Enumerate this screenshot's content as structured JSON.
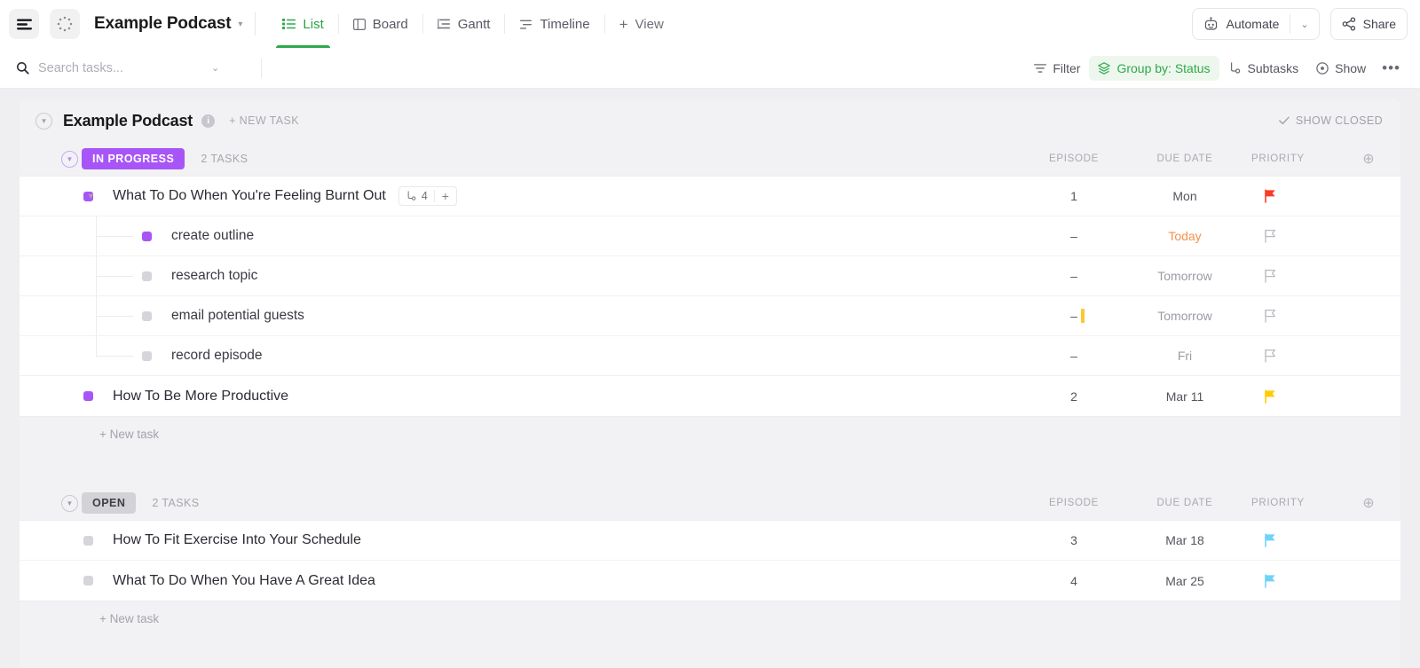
{
  "topbar": {
    "menu_icon": "hamburger-menu-icon",
    "space_icon": "dotted-circle-icon",
    "project_title": "Example Podcast",
    "caret": "▾",
    "tabs": [
      {
        "label": "List",
        "icon": "list-view-icon",
        "active": true
      },
      {
        "label": "Board",
        "icon": "board-view-icon",
        "active": false
      },
      {
        "label": "Gantt",
        "icon": "gantt-view-icon",
        "active": false
      },
      {
        "label": "Timeline",
        "icon": "timeline-view-icon",
        "active": false
      }
    ],
    "add_view_label": "View",
    "add_view_icon": "plus-icon",
    "automate_label": "Automate",
    "automate_icon": "robot-icon",
    "automate_caret": "⌄",
    "share_label": "Share",
    "share_icon": "share-nodes-icon"
  },
  "subbar": {
    "search_placeholder": "Search tasks...",
    "search_value": "",
    "search_icon": "search-icon",
    "search_caret": "⌄",
    "filter_label": "Filter",
    "filter_icon": "filter-icon",
    "group_label": "Group by: Status",
    "group_icon": "layers-icon",
    "subtasks_label": "Subtasks",
    "subtasks_icon": "subtask-icon",
    "show_label": "Show",
    "show_icon": "eye-icon",
    "more_label": "•••"
  },
  "list": {
    "title": "Example Podcast",
    "info_icon": "info-icon",
    "info_char": "i",
    "new_task_label": "+ NEW TASK",
    "show_closed_label": "SHOW CLOSED",
    "show_closed_icon": "check-icon",
    "columns": {
      "episode": "EPISODE",
      "due_date": "DUE DATE",
      "priority": "PRIORITY",
      "add_icon": "add-column-icon",
      "add_char": "⊕"
    },
    "new_task_footer": "+ New task"
  },
  "colors": {
    "in_progress_badge_bg": "#a855f7",
    "in_progress_badge_text": "#ffffff",
    "open_badge_bg": "#d3d3d7",
    "open_badge_text": "#3d3d45",
    "status_purple": "#a855f7",
    "status_gray": "#d5d5da",
    "accent_green": "#2ea94a",
    "flag_urgent": "#f93c24",
    "flag_normal": "#ffcb00",
    "flag_low": "#6fd3f7",
    "flag_none": "#b9b9c1",
    "today_text": "#f2924f",
    "cursor_yellow": "#fbc82e"
  },
  "groups": [
    {
      "status": "IN PROGRESS",
      "badge_style": "in-progress",
      "count_label": "2 TASKS",
      "tasks": [
        {
          "name": "What To Do When You're Feeling Burnt Out",
          "dot_color": "#a855f7",
          "episode": "1",
          "due_date": "Mon",
          "due_today": false,
          "priority": "urgent",
          "priority_color": "#f93c24",
          "expanded": true,
          "disclosure_char": "▾",
          "subtask_icon": "subtask-icon",
          "subtask_count": "4",
          "subtask_add": "+",
          "subtasks": [
            {
              "name": "create outline",
              "dot_color": "#a855f7",
              "episode": "–",
              "due_date": "Today",
              "due_today": true,
              "priority": "none",
              "priority_color": "#b9b9c1",
              "cursor": false
            },
            {
              "name": "research topic",
              "dot_color": "#d5d5da",
              "episode": "–",
              "due_date": "Tomorrow",
              "due_today": false,
              "priority": "none",
              "priority_color": "#b9b9c1",
              "cursor": false
            },
            {
              "name": "email potential guests",
              "dot_color": "#d5d5da",
              "episode": "–",
              "due_date": "Tomorrow",
              "due_today": false,
              "priority": "none",
              "priority_color": "#b9b9c1",
              "cursor": true
            },
            {
              "name": "record episode",
              "dot_color": "#d5d5da",
              "episode": "–",
              "due_date": "Fri",
              "due_today": false,
              "priority": "none",
              "priority_color": "#b9b9c1",
              "cursor": false
            }
          ]
        },
        {
          "name": "How To Be More Productive",
          "dot_color": "#a855f7",
          "episode": "2",
          "due_date": "Mar 11",
          "due_today": false,
          "priority": "normal",
          "priority_color": "#ffcb00",
          "expanded": false,
          "subtasks": []
        }
      ]
    },
    {
      "status": "OPEN",
      "badge_style": "open",
      "count_label": "2 TASKS",
      "tasks": [
        {
          "name": "How To Fit Exercise Into Your Schedule",
          "dot_color": "#d5d5da",
          "episode": "3",
          "due_date": "Mar 18",
          "due_today": false,
          "priority": "low",
          "priority_color": "#6fd3f7",
          "expanded": false,
          "subtasks": []
        },
        {
          "name": "What To Do When You Have A Great Idea",
          "dot_color": "#d5d5da",
          "episode": "4",
          "due_date": "Mar 25",
          "due_today": false,
          "priority": "low",
          "priority_color": "#6fd3f7",
          "expanded": false,
          "subtasks": []
        }
      ]
    }
  ]
}
